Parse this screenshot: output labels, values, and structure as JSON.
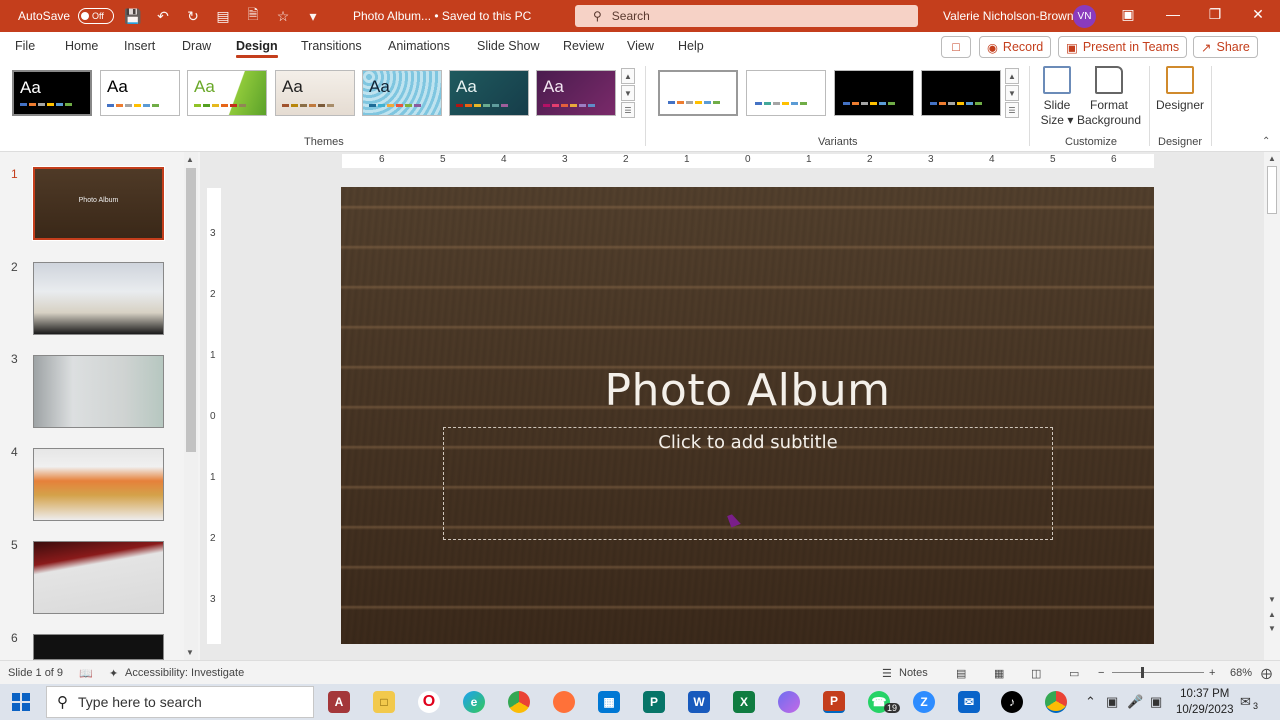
{
  "titlebar": {
    "autosave_label": "AutoSave",
    "autosave_state": "Off",
    "doc_title": "Photo Album...  •  Saved to this PC",
    "search_placeholder": "Search",
    "user_name": "Valerie Nicholson-Brown",
    "user_initials": "VN"
  },
  "menu": {
    "tabs": [
      "File",
      "Home",
      "Insert",
      "Draw",
      "Design",
      "Transitions",
      "Animations",
      "Slide Show",
      "Review",
      "View",
      "Help"
    ],
    "active_tab": "Design",
    "record_label": "Record",
    "teams_label": "Present in Teams",
    "share_label": "Share"
  },
  "ribbon": {
    "themes_group_label": "Themes",
    "theme_sample_text": "Aa",
    "variants_group_label": "Variants",
    "customize_group_label": "Customize",
    "designer_group_label": "Designer",
    "slide_size_line1": "Slide",
    "slide_size_line2": "Size",
    "format_bg_line1": "Format",
    "format_bg_line2": "Background",
    "designer_button": "Designer"
  },
  "slides_pane": {
    "numbers": [
      "1",
      "2",
      "3",
      "4",
      "5",
      "6"
    ],
    "thumb1_title": "Photo Album"
  },
  "ruler": {
    "h_labels": [
      "6",
      "5",
      "4",
      "3",
      "2",
      "1",
      "0",
      "1",
      "2",
      "3",
      "4",
      "5",
      "6"
    ],
    "v_labels": [
      "3",
      "2",
      "1",
      "0",
      "1",
      "2",
      "3"
    ]
  },
  "slide": {
    "title": "Photo Album",
    "subtitle_placeholder": "Click to add subtitle"
  },
  "statusbar": {
    "slide_counter": "Slide 1 of 9",
    "accessibility": "Accessibility: Investigate",
    "notes": "Notes",
    "zoom": "68%"
  },
  "taskbar": {
    "search_placeholder": "Type here to search",
    "time": "10:37 PM",
    "date": "10/29/2023",
    "whatsapp_badge": "19",
    "notif_count": "3"
  },
  "colors": {
    "accent": "#c43e1c",
    "slide_bg": "#4a3523"
  }
}
